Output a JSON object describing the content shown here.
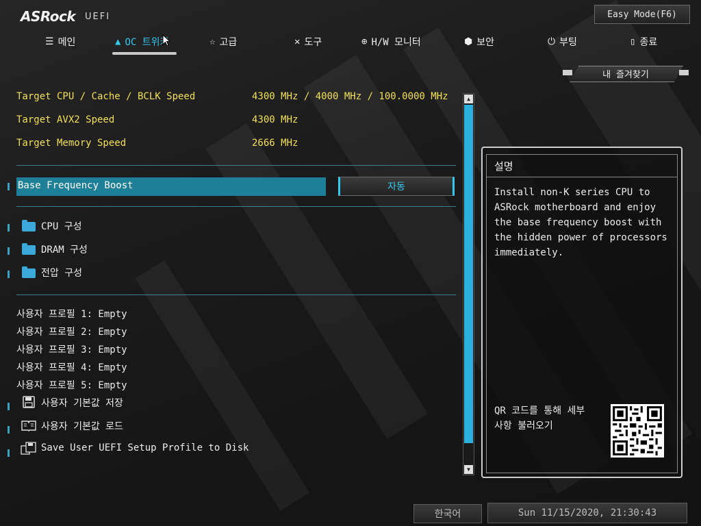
{
  "header": {
    "logo": "ASRock",
    "logo_sub": "UEFI",
    "easy_mode": "Easy Mode(F6)",
    "favorites": "내 즐겨찾기"
  },
  "tabs": [
    {
      "label": "메인",
      "icon": "list-icon"
    },
    {
      "label": "OC 트위커",
      "icon": "rocket-icon",
      "active": true
    },
    {
      "label": "고급",
      "icon": "star-icon"
    },
    {
      "label": "도구",
      "icon": "tools-icon"
    },
    {
      "label": "H/W 모니터",
      "icon": "crosshair-icon"
    },
    {
      "label": "보안",
      "icon": "shield-icon"
    },
    {
      "label": "부팅",
      "icon": "power-icon"
    },
    {
      "label": "종료",
      "icon": "exit-door-icon"
    }
  ],
  "info": [
    {
      "label": "Target CPU / Cache / BCLK Speed",
      "value": "4300 MHz / 4000 MHz / 100.0000 MHz"
    },
    {
      "label": "Target AVX2 Speed",
      "value": "4300 MHz"
    },
    {
      "label": "Target Memory Speed",
      "value": "2666 MHz"
    }
  ],
  "selected_setting": {
    "label": "Base Frequency Boost",
    "value": "자동"
  },
  "folders": [
    {
      "label": "CPU 구성"
    },
    {
      "label": "DRAM 구성"
    },
    {
      "label": "전압 구성"
    }
  ],
  "profiles": [
    "사용자 프로필 1: Empty",
    "사용자 프로필 2: Empty",
    "사용자 프로필 3: Empty",
    "사용자 프로필 4: Empty",
    "사용자 프로필 5: Empty"
  ],
  "actions": [
    {
      "label": "사용자 기본값 저장",
      "icon": "floppy-disk-icon"
    },
    {
      "label": "사용자 기본값 로드",
      "icon": "book-icon"
    },
    {
      "label": "Save User UEFI Setup Profile to Disk",
      "icon": "save-to-disk-icon"
    }
  ],
  "description": {
    "title": "설명",
    "lines": [
      "Install non-K series CPU to",
      "ASRock motherboard and enjoy",
      "the base frequency boost with",
      "the hidden power of processors",
      "immediately."
    ],
    "qr_text": [
      "QR 코드를 통해 세부",
      "사항 불러오기"
    ]
  },
  "footer": {
    "language": "한국어",
    "datetime": "Sun 11/15/2020, 21:30:43"
  },
  "colors": {
    "accent": "#36c8ee",
    "highlight_row": "#1e7f98",
    "info_text": "#f0e05a"
  }
}
